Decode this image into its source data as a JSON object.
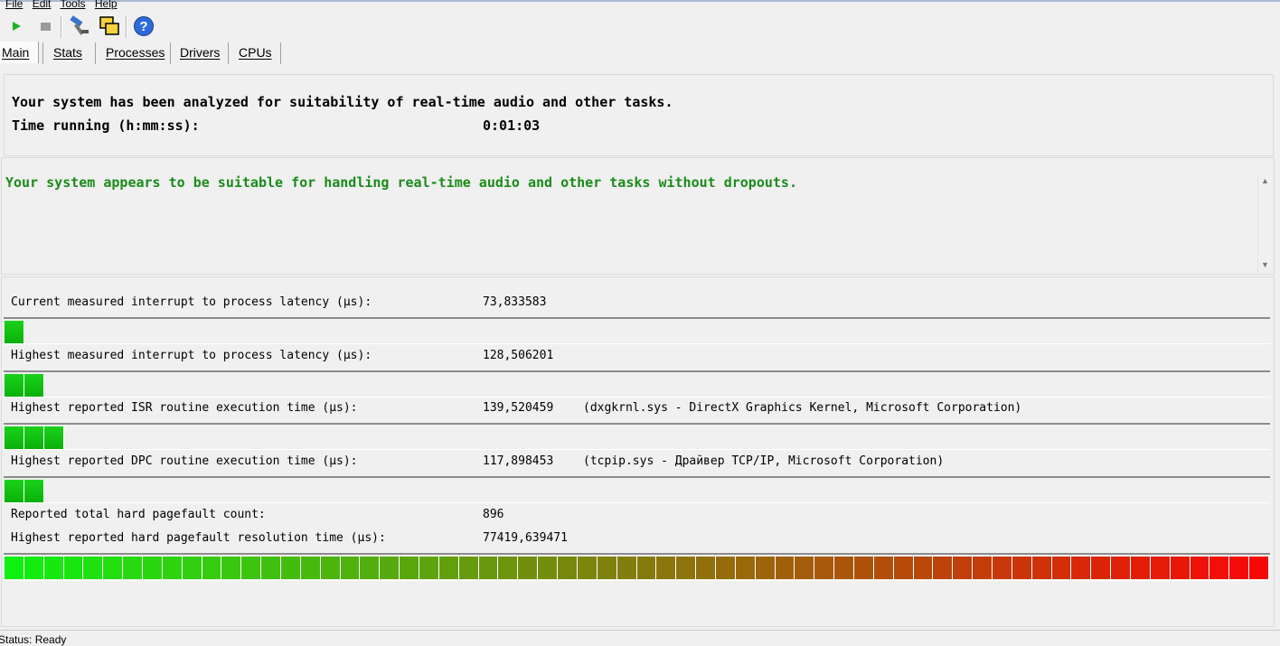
{
  "menu": {
    "items": [
      "File",
      "Edit",
      "Tools",
      "Help"
    ]
  },
  "toolbar": {
    "buttons": [
      {
        "name": "play-icon"
      },
      {
        "name": "stop-icon"
      },
      {
        "name": "hammer-icon"
      },
      {
        "name": "windows-icon"
      },
      {
        "name": "help-icon"
      }
    ]
  },
  "tabs": [
    "Main",
    "Stats",
    "Processes",
    "Drivers",
    "CPUs"
  ],
  "analysis": {
    "line1": "Your system has been analyzed for suitability of real-time audio and other tasks.",
    "time_label": "Time running (h:mm:ss):",
    "time_value": "0:01:03"
  },
  "verdict": {
    "message": "Your system appears to be suitable for handling real-time audio and other tasks without dropouts.",
    "color": "#1a8c1a"
  },
  "metrics": [
    {
      "label": "Current measured interrupt to process latency (µs):",
      "value": "73,833583",
      "detail": "",
      "bar_segments": 1
    },
    {
      "label": "Highest measured interrupt to process latency (µs):",
      "value": "128,506201",
      "detail": "",
      "bar_segments": 2
    },
    {
      "label": "Highest reported ISR routine execution time (µs):",
      "value": "139,520459",
      "detail": "(dxgkrnl.sys - DirectX Graphics Kernel, Microsoft Corporation)",
      "bar_segments": 3
    },
    {
      "label": "Highest reported DPC routine execution time (µs):",
      "value": "117,898453",
      "detail": "(tcpip.sys - Драйвер TCP/IP, Microsoft Corporation)",
      "bar_segments": 2
    }
  ],
  "pagefault": {
    "count_label": "Reported total hard pagefault count:",
    "count_value": "896",
    "time_label": "Highest reported hard pagefault resolution time (µs):",
    "time_value": "77419,639471",
    "bar_segments": 64,
    "gradient_start": "#10f010",
    "gradient_end": "#f80808"
  },
  "status": {
    "text": "Status: Ready"
  }
}
